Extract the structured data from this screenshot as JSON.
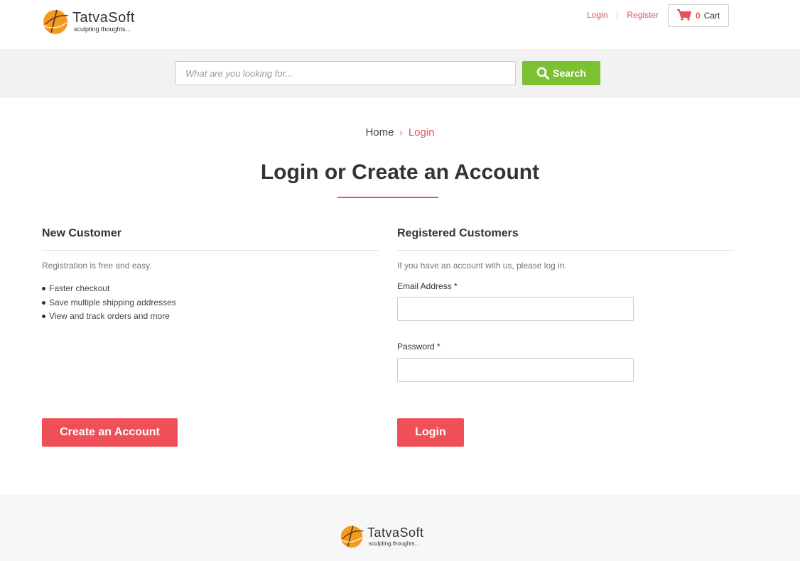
{
  "brand": {
    "name": "TatvaSoft",
    "tagline": "sculpting thoughts...",
    "accent": "#e8505b",
    "green": "#7cc132"
  },
  "header": {
    "login_link": "Login",
    "register_link": "Register",
    "cart_count": "0",
    "cart_label": "Cart",
    "cart_icon": "shopping-cart-icon"
  },
  "search": {
    "placeholder": "What are you looking for...",
    "value": "",
    "button_label": "Search",
    "button_icon": "search-icon"
  },
  "breadcrumb": {
    "home": "Home",
    "separator": "›",
    "current": "Login"
  },
  "page_title": "Login or Create an Account",
  "new_customer": {
    "heading": "New Customer",
    "description": "Registration is free and easy.",
    "benefits": [
      "Faster checkout",
      "Save multiple shipping addresses",
      "View and track orders and more"
    ],
    "button_label": "Create an Account"
  },
  "registered": {
    "heading": "Registered Customers",
    "description": "If you have an account with us, please log in.",
    "email_label": "Email Address *",
    "email_value": "",
    "password_label": "Password *",
    "password_value": "",
    "button_label": "Login"
  },
  "footer": {
    "brand_name": "TatvaSoft",
    "tagline": "sculpting thoughts..."
  }
}
